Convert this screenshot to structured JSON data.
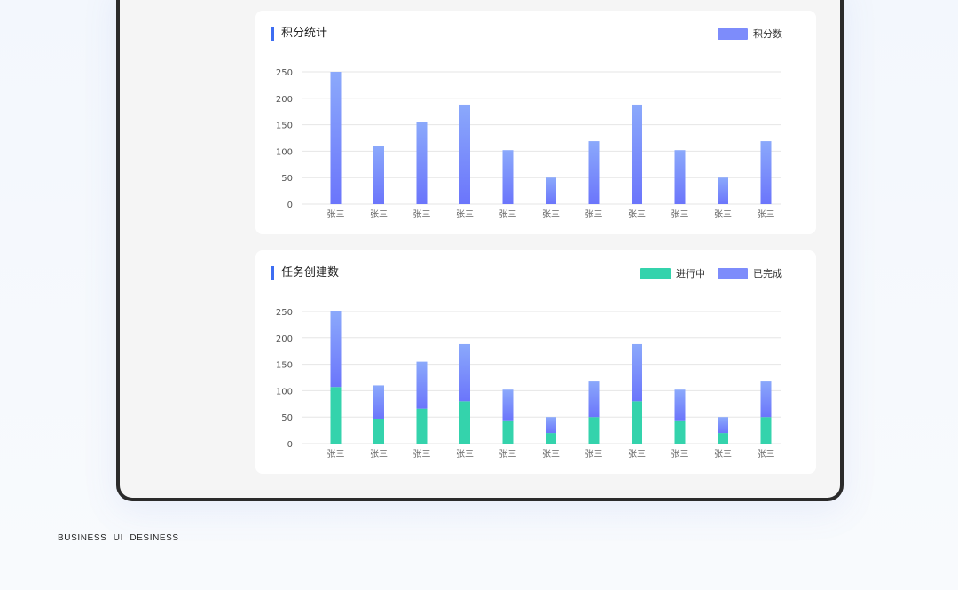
{
  "footer": "BUSINESS  UI  DESINESS",
  "colors": {
    "blue_top": "#8ba9fb",
    "blue_bottom": "#6b75fb",
    "green": "#34d3ac",
    "title_bar": "#3d6df2"
  },
  "chart_data": [
    {
      "type": "bar",
      "title": "积分统计",
      "categories": [
        "张三",
        "张三",
        "张三",
        "张三",
        "张三",
        "张三",
        "张三",
        "张三",
        "张三",
        "张三",
        "张三"
      ],
      "series": [
        {
          "name": "积分数",
          "values": [
            250,
            110,
            155,
            188,
            102,
            50,
            119,
            188,
            102,
            50,
            119
          ]
        }
      ],
      "ylim": [
        0,
        250
      ],
      "yticks": [
        0,
        50,
        100,
        150,
        200,
        250
      ],
      "grid": true,
      "legend": "top-right"
    },
    {
      "type": "bar",
      "stacked": true,
      "title": "任务创建数",
      "categories": [
        "张三",
        "张三",
        "张三",
        "张三",
        "张三",
        "张三",
        "张三",
        "张三",
        "张三",
        "张三",
        "张三"
      ],
      "series": [
        {
          "name": "进行中",
          "values": [
            107,
            47,
            66,
            80,
            44,
            20,
            50,
            80,
            44,
            20,
            50
          ]
        },
        {
          "name": "已完成",
          "values": [
            143,
            63,
            89,
            108,
            58,
            30,
            69,
            108,
            58,
            30,
            69
          ]
        }
      ],
      "ylim": [
        0,
        250
      ],
      "yticks": [
        0,
        50,
        100,
        150,
        200,
        250
      ],
      "grid": true,
      "legend": "top-right"
    }
  ]
}
